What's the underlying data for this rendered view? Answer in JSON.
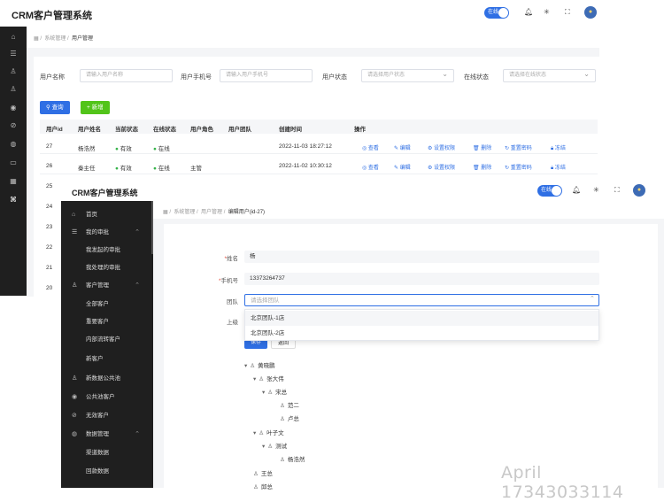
{
  "app_title": "CRM客户管理系统",
  "online_toggle": "在线",
  "bg": {
    "breadcrumb": [
      "系统管理",
      "用户管理"
    ],
    "filters": {
      "username_label": "用户名称",
      "username_ph": "请输入用户名称",
      "phone_label": "用户手机号",
      "phone_ph": "请输入用户手机号",
      "status_label": "用户状态",
      "status_ph": "请选择用户状态",
      "online_label": "在线状态",
      "online_ph": "请选择在线状态"
    },
    "search_btn": "查询",
    "add_btn": "新增",
    "columns": [
      "用户id",
      "用户姓名",
      "当前状态",
      "在线状态",
      "用户角色",
      "用户团队",
      "创建时间",
      "操作"
    ],
    "rows": [
      {
        "id": "27",
        "name": "杨浩然",
        "status": "有效",
        "online": "在线",
        "role": "",
        "time": "2022-11-03 18:27:12"
      },
      {
        "id": "26",
        "name": "秦主任",
        "status": "有效",
        "online": "在线",
        "role": "主管",
        "time": "2022-11-02 10:30:12"
      }
    ],
    "extra_ids": [
      "25",
      "24",
      "23",
      "22",
      "21",
      "20"
    ],
    "actions": [
      "查看",
      "编辑",
      "设置权限",
      "删除",
      "重置密码",
      "冻结"
    ]
  },
  "fg": {
    "breadcrumb": [
      "系统管理",
      "用户管理",
      "编辑用户(id-27)"
    ],
    "menu": [
      {
        "label": "首页",
        "icon": "home"
      },
      {
        "label": "我的审批",
        "icon": "list",
        "open": true
      },
      {
        "label": "我发起的审批",
        "sub": true
      },
      {
        "label": "我处理的审批",
        "sub": true
      },
      {
        "label": "客户管理",
        "icon": "users",
        "open": true
      },
      {
        "label": "全部客户",
        "sub": true
      },
      {
        "label": "重要客户",
        "sub": true
      },
      {
        "label": "内部流转客户",
        "sub": true
      },
      {
        "label": "新客户",
        "sub": true
      },
      {
        "label": "新数据公共池",
        "icon": "user"
      },
      {
        "label": "公共池客户",
        "icon": "coin"
      },
      {
        "label": "无效客户",
        "icon": "ban"
      },
      {
        "label": "数据管理",
        "icon": "data",
        "open": true
      },
      {
        "label": "渠道数据",
        "sub": true
      },
      {
        "label": "回款数据",
        "sub": true
      }
    ],
    "name_label": "姓名",
    "name_value": "杨",
    "phone_label": "手机号",
    "phone_value": "13373264737",
    "team_label": "团队",
    "team_ph": "请选择团队",
    "superior_label": "上级",
    "team_options": [
      "北京团队-1店",
      "北京团队-2店"
    ],
    "save_btn": "保存",
    "back_btn": "返回",
    "tree": [
      "黄晓鹏",
      "张大伟",
      "宋总",
      "范二",
      "卢总",
      "叶子文",
      "测试",
      "杨浩然",
      "王总",
      "邱总"
    ]
  },
  "watermark": "April 17343033114"
}
